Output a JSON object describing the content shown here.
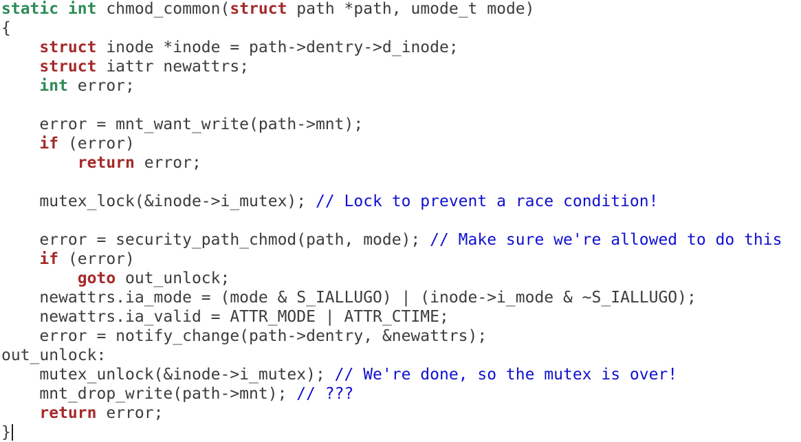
{
  "editor": {
    "colors": {
      "type_keyword": "#2e8b57",
      "keyword": "#a52a2a",
      "comment": "#1010d0",
      "text": "#3c3c3c"
    },
    "lines": [
      [
        {
          "t": "static int",
          "c": "kw-type"
        },
        {
          "t": " chmod_common(",
          "c": "plain"
        },
        {
          "t": "struct",
          "c": "kw"
        },
        {
          "t": " path *path, umode_t mode)",
          "c": "plain"
        }
      ],
      [
        {
          "t": "{",
          "c": "plain"
        }
      ],
      [
        {
          "t": "    ",
          "c": "plain"
        },
        {
          "t": "struct",
          "c": "kw"
        },
        {
          "t": " inode *inode = path->dentry->d_inode;",
          "c": "plain"
        }
      ],
      [
        {
          "t": "    ",
          "c": "plain"
        },
        {
          "t": "struct",
          "c": "kw"
        },
        {
          "t": " iattr newattrs;",
          "c": "plain"
        }
      ],
      [
        {
          "t": "    ",
          "c": "plain"
        },
        {
          "t": "int",
          "c": "kw-type"
        },
        {
          "t": " error;",
          "c": "plain"
        }
      ],
      [],
      [
        {
          "t": "    error = mnt_want_write(path->mnt);",
          "c": "plain"
        }
      ],
      [
        {
          "t": "    ",
          "c": "plain"
        },
        {
          "t": "if",
          "c": "kw"
        },
        {
          "t": " (error)",
          "c": "plain"
        }
      ],
      [
        {
          "t": "        ",
          "c": "plain"
        },
        {
          "t": "return",
          "c": "kw"
        },
        {
          "t": " error;",
          "c": "plain"
        }
      ],
      [],
      [
        {
          "t": "    mutex_lock(&inode->i_mutex); ",
          "c": "plain"
        },
        {
          "t": "// Lock to prevent a race condition!",
          "c": "cm"
        }
      ],
      [],
      [
        {
          "t": "    error = security_path_chmod(path, mode); ",
          "c": "plain"
        },
        {
          "t": "// Make sure we're allowed to do this",
          "c": "cm"
        }
      ],
      [
        {
          "t": "    ",
          "c": "plain"
        },
        {
          "t": "if",
          "c": "kw"
        },
        {
          "t": " (error)",
          "c": "plain"
        }
      ],
      [
        {
          "t": "        ",
          "c": "plain"
        },
        {
          "t": "goto",
          "c": "kw"
        },
        {
          "t": " out_unlock;",
          "c": "plain"
        }
      ],
      [
        {
          "t": "    newattrs.ia_mode = (mode & S_IALLUGO) | (inode->i_mode & ~S_IALLUGO);",
          "c": "plain"
        }
      ],
      [
        {
          "t": "    newattrs.ia_valid = ATTR_MODE | ATTR_CTIME;",
          "c": "plain"
        }
      ],
      [
        {
          "t": "    error = notify_change(path->dentry, &newattrs);",
          "c": "plain"
        }
      ],
      [
        {
          "t": "out_unlock:",
          "c": "plain"
        }
      ],
      [
        {
          "t": "    mutex_unlock(&inode->i_mutex); ",
          "c": "plain"
        },
        {
          "t": "// We're done, so the mutex is over!",
          "c": "cm"
        }
      ],
      [
        {
          "t": "    mnt_drop_write(path->mnt); ",
          "c": "plain"
        },
        {
          "t": "// ???",
          "c": "cm"
        }
      ],
      [
        {
          "t": "    ",
          "c": "plain"
        },
        {
          "t": "return",
          "c": "kw"
        },
        {
          "t": " error;",
          "c": "plain"
        }
      ],
      [
        {
          "t": "}",
          "c": "plain"
        }
      ]
    ],
    "cursor_line": 22
  }
}
